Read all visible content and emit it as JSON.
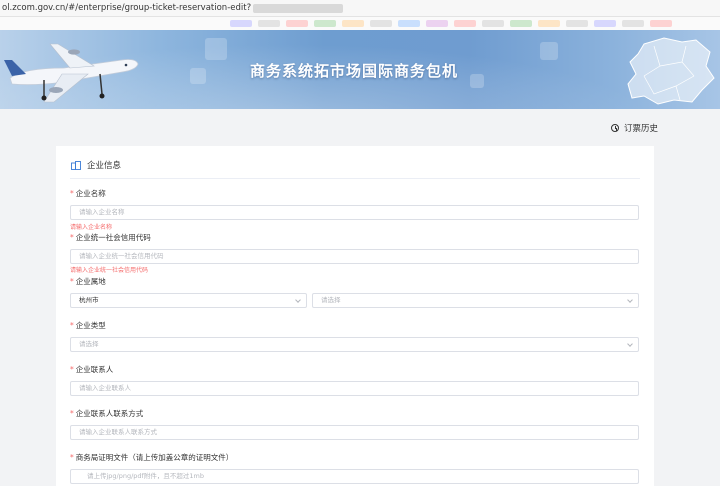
{
  "browser": {
    "url": "ol.zcom.gov.cn/#/enterprise/group-ticket-reservation-edit?"
  },
  "banner": {
    "title": "商务系统拓市场国际商务包机"
  },
  "toolbar": {
    "history_label": "订票历史"
  },
  "section": {
    "title": "企业信息"
  },
  "form": {
    "company_name": {
      "label": "企业名称",
      "placeholder": "请输入企业名称",
      "error": "请输入企业名称"
    },
    "credit_code": {
      "label": "企业统一社会信用代码",
      "placeholder": "请输入企业统一社会信用代码",
      "error": "请输入企业统一社会信用代码"
    },
    "region": {
      "label": "企业属地",
      "city_value": "杭州市",
      "district_placeholder": "请选择"
    },
    "company_type": {
      "label": "企业类型",
      "placeholder": "请选择"
    },
    "contact": {
      "label": "企业联系人",
      "placeholder": "请输入企业联系人"
    },
    "contact_phone": {
      "label": "企业联系人联系方式",
      "placeholder": "请输入企业联系人联系方式"
    },
    "proof_file": {
      "label": "商务局证明文件（请上传加盖公章的证明文件）",
      "placeholder": "请上传jpg/png/pdf附件，且不超过1mb"
    }
  }
}
